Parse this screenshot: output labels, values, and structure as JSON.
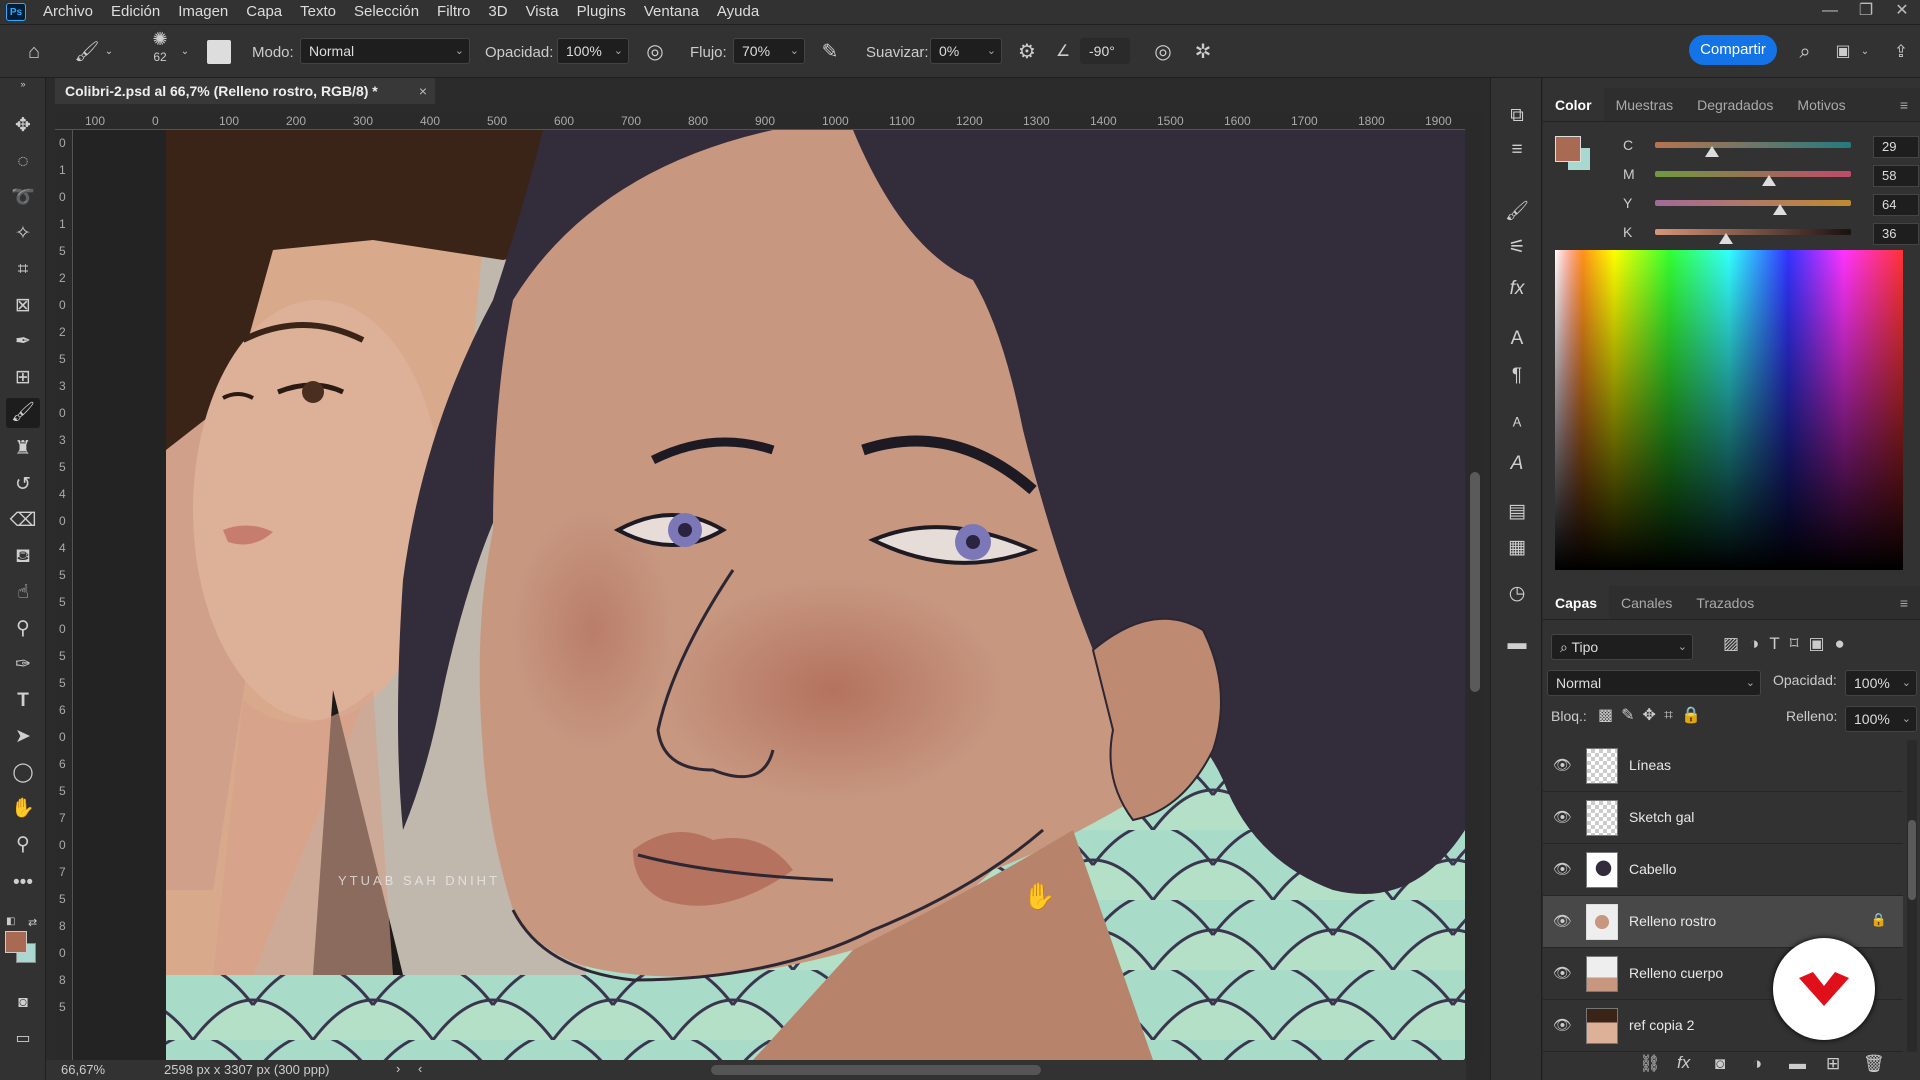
{
  "menubar": {
    "logo": "Ps",
    "items": [
      "Archivo",
      "Edición",
      "Imagen",
      "Capa",
      "Texto",
      "Selección",
      "Filtro",
      "3D",
      "Vista",
      "Plugins",
      "Ventana",
      "Ayuda"
    ]
  },
  "options": {
    "brush_size": "62",
    "mode_label": "Modo:",
    "mode_value": "Normal",
    "opacity_label": "Opacidad:",
    "opacity_value": "100%",
    "flow_label": "Flujo:",
    "flow_value": "70%",
    "smoothing_label": "Suavizar:",
    "smoothing_value": "0%",
    "angle_value": "-90°",
    "share_label": "Compartir"
  },
  "document": {
    "tab_title": "Colibri-2.psd al 66,7% (Relleno rostro, RGB/8) *",
    "close": "×",
    "zoom": "66,67%",
    "size_info": "2598 px x 3307 px (300 ppp)",
    "watermark": "YTUAB SAH DNIHT",
    "ruler_h": [
      "100",
      "0",
      "100",
      "200",
      "300",
      "400",
      "500",
      "600",
      "700",
      "800",
      "900",
      "1000",
      "1100",
      "1200",
      "1300",
      "1400",
      "1500",
      "1600",
      "1700",
      "1800",
      "1900"
    ],
    "ruler_v": [
      "0",
      "1",
      "0",
      "1",
      "5",
      "2",
      "0",
      "2",
      "5",
      "3",
      "0",
      "3",
      "5",
      "4",
      "0",
      "4",
      "5",
      "5",
      "0",
      "5",
      "5",
      "6",
      "0",
      "6",
      "5",
      "7",
      "0",
      "7",
      "5",
      "8",
      "0",
      "8",
      "5"
    ]
  },
  "color_panel": {
    "tabs": [
      "Color",
      "Muestras",
      "Degradados",
      "Motivos"
    ],
    "foreground": "#a86a52",
    "background": "#a8d8d0",
    "sliders": [
      {
        "label": "C",
        "value": "29",
        "pct": "%",
        "fraction": 0.29
      },
      {
        "label": "M",
        "value": "58",
        "pct": "%",
        "fraction": 0.58
      },
      {
        "label": "Y",
        "value": "64",
        "pct": "%",
        "fraction": 0.64
      },
      {
        "label": "K",
        "value": "36",
        "pct": "%",
        "fraction": 0.36
      }
    ]
  },
  "layers_panel": {
    "tabs": [
      "Capas",
      "Canales",
      "Trazados"
    ],
    "filter_value": "Tipo",
    "blend_value": "Normal",
    "opacity_label": "Opacidad:",
    "opacity_value": "100%",
    "lock_label": "Bloq.:",
    "fill_label": "Relleno:",
    "fill_value": "100%",
    "layers": [
      {
        "name": "Líneas",
        "selected": false,
        "locked": false
      },
      {
        "name": "Sketch gal",
        "selected": false,
        "locked": false
      },
      {
        "name": "Cabello",
        "selected": false,
        "locked": false
      },
      {
        "name": "Relleno rostro",
        "selected": true,
        "locked": true
      },
      {
        "name": "Relleno cuerpo",
        "selected": false,
        "locked": false
      },
      {
        "name": "ref copia 2",
        "selected": false,
        "locked": false
      }
    ]
  },
  "colors": {
    "accent": "#1473e6",
    "hair": "#332c3a",
    "skin": "#c79780",
    "blush": "#b5735f",
    "bg_teal": "#a8d8c8"
  }
}
